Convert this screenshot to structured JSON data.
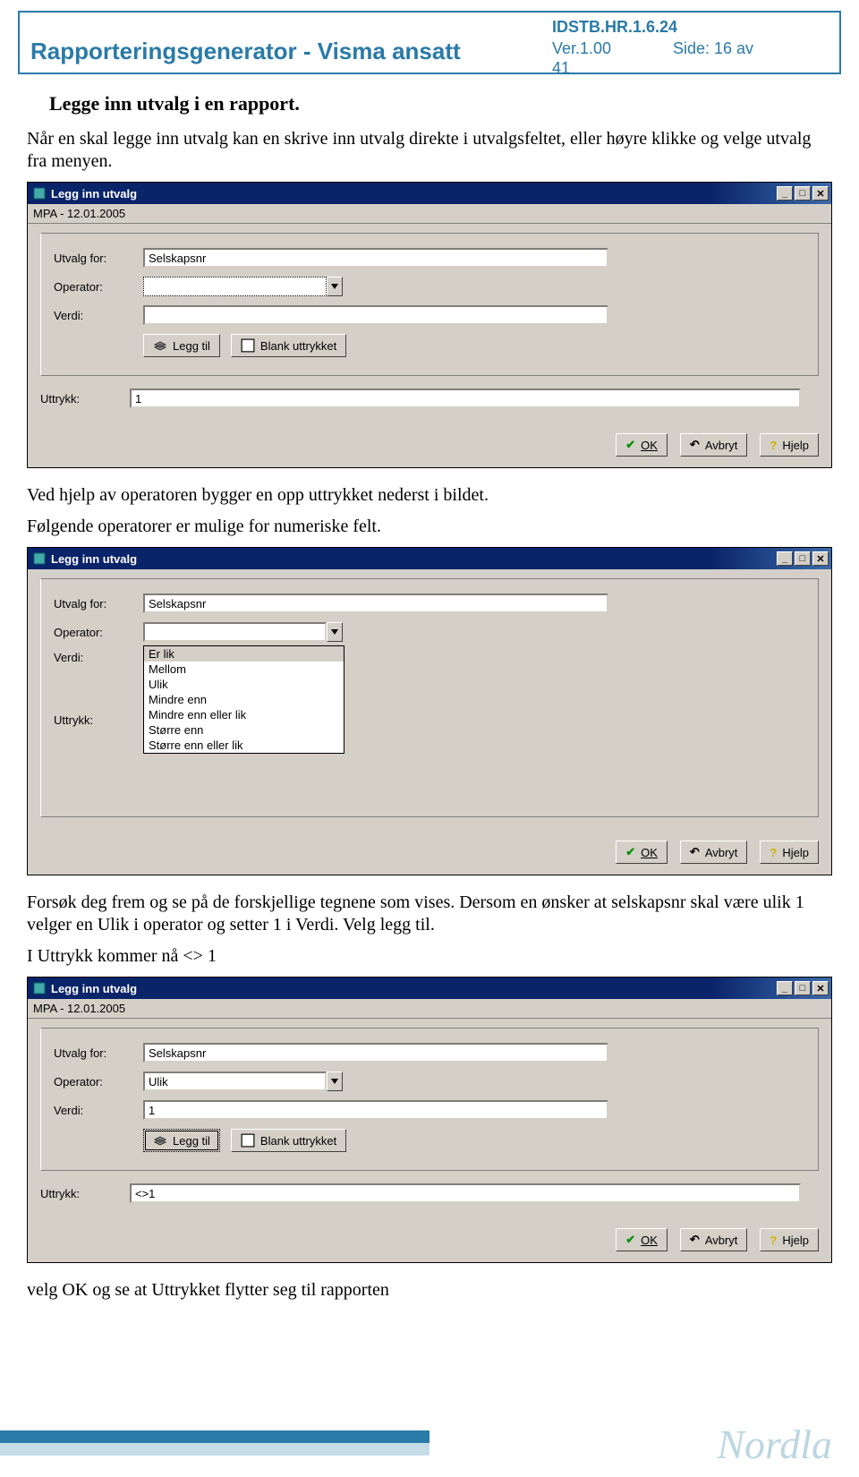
{
  "header": {
    "id": "IDSTB.HR.1.6.24",
    "title": "Rapporteringsgenerator - Visma ansatt",
    "version": "Ver.1.00",
    "side": "Side: 16 av",
    "pages": "41"
  },
  "section_heading": "Legge inn utvalg i en rapport.",
  "para1": "Når en skal legge inn utvalg kan en skrive inn utvalg direkte i utvalgsfeltet, eller høyre klikke og velge utvalg fra menyen.",
  "para2a": "Ved hjelp av operatoren bygger en opp uttrykket nederst i bildet.",
  "para2b": "Følgende operatorer er mulige for numeriske felt.",
  "para3a": "Forsøk deg frem og se på de forskjellige tegnene som vises. Dersom en ønsker at selskapsnr skal være ulik 1 velger en Ulik i operator og setter 1 i Verdi. Velg legg til.",
  "para3b": "I Uttrykk kommer nå <> 1",
  "para4": "velg OK og se at Uttrykket flytter seg til rapporten",
  "dialog": {
    "title": "Legg inn utvalg",
    "subtitle": "MPA - 12.01.2005",
    "labels": {
      "utvalg_for": "Utvalg for:",
      "operator": "Operator:",
      "verdi": "Verdi:",
      "uttrykk": "Uttrykk:"
    },
    "btn_legg_til": "Legg til",
    "btn_blank": "Blank uttrykket",
    "btn_ok": "OK",
    "btn_avbryt": "Avbryt",
    "btn_hjelp": "Hjelp"
  },
  "d1": {
    "utvalg_for": "Selskapsnr",
    "operator": "",
    "verdi": "",
    "uttrykk": "1"
  },
  "d2": {
    "utvalg_for": "Selskapsnr",
    "operator": "",
    "verdi": "",
    "uttrykk": "",
    "options": [
      "Er lik",
      "Mellom",
      "Ulik",
      "Mindre enn",
      "Mindre enn eller lik",
      "Større enn",
      "Større enn eller lik"
    ]
  },
  "d3": {
    "utvalg_for": "Selskapsnr",
    "operator": "Ulik",
    "verdi": "1",
    "uttrykk": "<>1"
  },
  "footer_logo": "Nordla"
}
